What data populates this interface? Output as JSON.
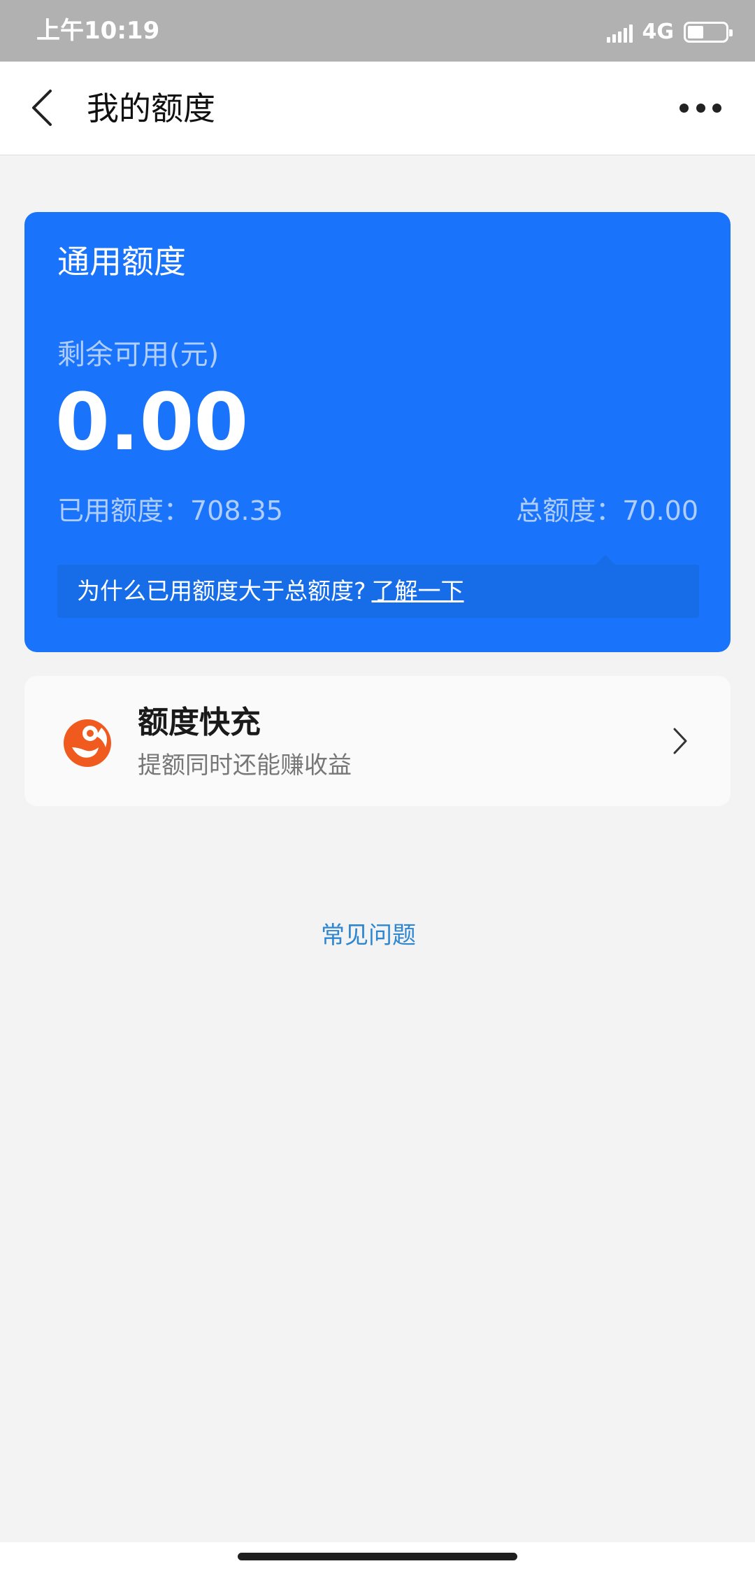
{
  "status_bar": {
    "time": "上午10:19",
    "network": "4G",
    "icons": [
      "signal-icon",
      "battery-icon"
    ]
  },
  "nav": {
    "title": "我的额度",
    "back_icon": "chevron-left-icon",
    "more_icon": "more-dots-icon"
  },
  "quota_card": {
    "title": "通用额度",
    "remaining_label": "剩余可用(元)",
    "remaining_value": "0.00",
    "used_text": "已用额度：708.35",
    "total_text": "总额度：70.00",
    "tip_text": "为什么已用额度大于总额度?",
    "tip_link": "了解一下",
    "color": "#1a73fb"
  },
  "boost": {
    "title": "额度快充",
    "subtitle": "提额同时还能赚收益",
    "icon": "orange-logo-icon",
    "arrow_icon": "chevron-right-icon"
  },
  "faq_link": "常见问题",
  "colors": {
    "status_bar": "#b1b1b1",
    "background": "#f3f3f3",
    "link": "#2f86d0",
    "logo": "#f05a1e"
  }
}
